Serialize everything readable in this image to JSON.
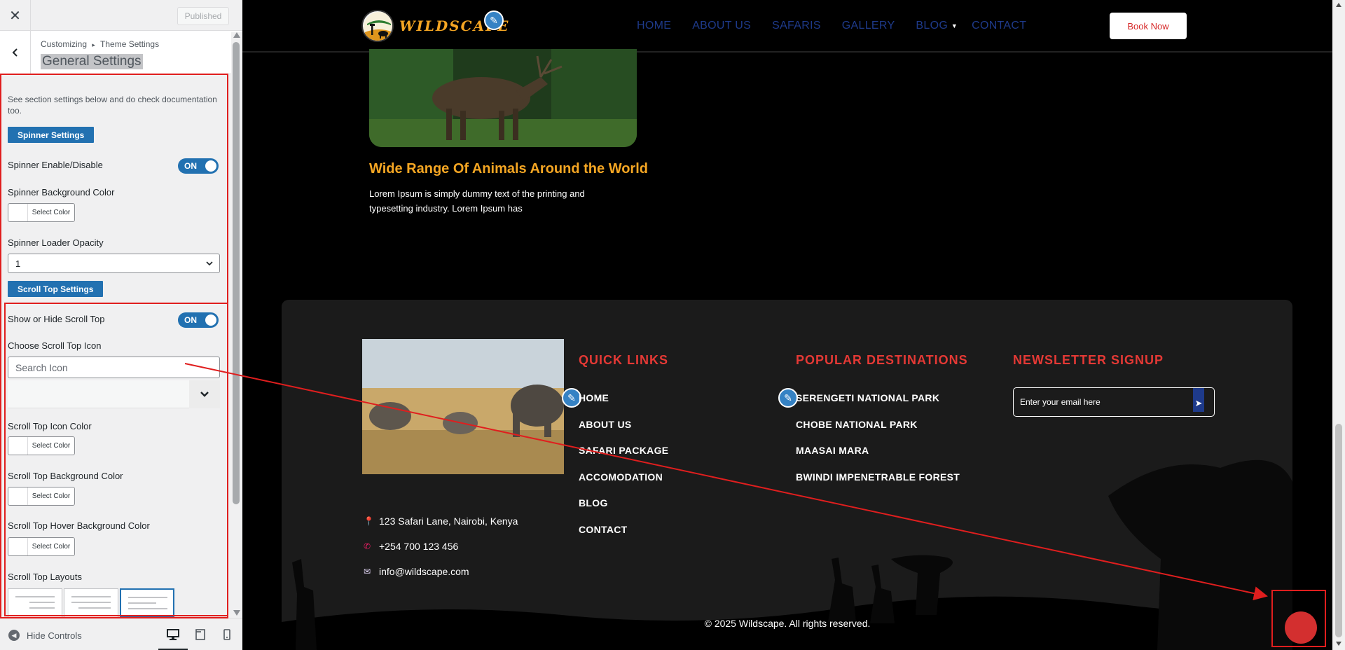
{
  "customizer": {
    "close_label": "✕",
    "published_label": "Published",
    "breadcrumb_root": "Customizing",
    "breadcrumb_sep": "▸",
    "breadcrumb_parent": "Theme Settings",
    "section_title": "General Settings",
    "description": "See section settings below and do check documentation too.",
    "spinner_section": "Spinner Settings",
    "spinner_enable_label": "Spinner Enable/Disable",
    "spinner_enable_state": "ON",
    "spinner_bg_label": "Spinner Background Color",
    "select_color": "Select Color",
    "spinner_opacity_label": "Spinner Loader Opacity",
    "spinner_opacity_value": "1",
    "scroll_section": "Scroll Top Settings",
    "scroll_show_label": "Show or Hide Scroll Top",
    "scroll_show_state": "ON",
    "scroll_icon_label": "Choose Scroll Top Icon",
    "scroll_icon_placeholder": "Search Icon",
    "scroll_icon_color_label": "Scroll Top Icon Color",
    "scroll_bg_label": "Scroll Top Background Color",
    "scroll_hover_bg_label": "Scroll Top Hover Background Color",
    "scroll_layouts_label": "Scroll Top Layouts",
    "hide_controls": "Hide Controls",
    "accent": "#2271b1"
  },
  "site": {
    "logo_text": "WILDSCAPE",
    "nav": [
      "HOME",
      "ABOUT US",
      "SAFARIS",
      "GALLERY",
      "BLOG",
      "CONTACT"
    ],
    "book_now": "Book Now",
    "post_title": "Wide Range Of Animals Around the World",
    "post_excerpt": "Lorem Ipsum is simply dummy text of the printing and typesetting industry. Lorem Ipsum has",
    "footer": {
      "quick_links_heading": "QUICK LINKS",
      "quick_links": [
        "HOME",
        "ABOUT US",
        "SAFARI PACKAGE",
        "ACCOMODATION",
        "BLOG",
        "CONTACT"
      ],
      "destinations_heading": "POPULAR DESTINATIONS",
      "destinations": [
        "SERENGETI NATIONAL PARK",
        "CHOBE NATIONAL PARK",
        "MAASAI MARA",
        "BWINDI IMPENETRABLE FOREST"
      ],
      "newsletter_heading": "NEWSLETTER SIGNUP",
      "newsletter_placeholder": "Enter your email here",
      "address": "123 Safari Lane, Nairobi, Kenya",
      "phone": "+254 700 123 456",
      "email": "info@wildscape.com"
    },
    "copyright": "© 2025 Wildscape. All rights reserved.",
    "colors": {
      "heading_orange": "#f5a623",
      "footer_red": "#e53935",
      "nav_blue": "#1e3a8a",
      "scroll_button": "#d32f2f"
    }
  }
}
